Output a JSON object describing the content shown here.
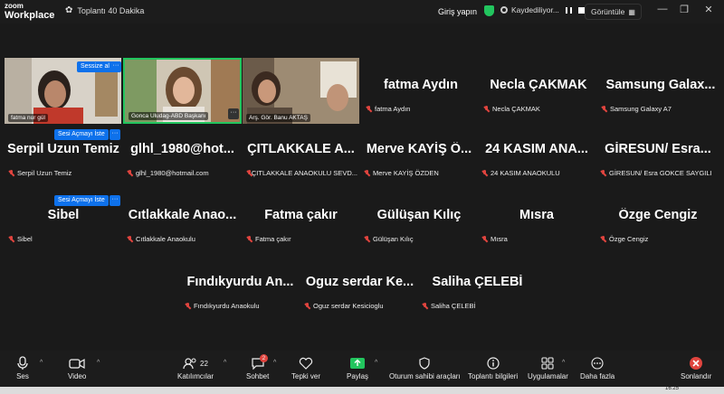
{
  "window": {
    "logo_line1": "zoom",
    "logo_line2": "Workplace",
    "meeting_title": "Toplantı 40 Dakika",
    "join_label": "Giriş yapın",
    "recording_label": "Kaydediliyor...",
    "view_label": "Görüntüle",
    "minimize": "—",
    "restore": "❐",
    "close": "✕"
  },
  "video_tiles": [
    {
      "label": "fatma nur gül",
      "mute_label": "Sessize al"
    },
    {
      "label": "Gonca Uludag-ABD Başkanı"
    },
    {
      "label": "Arş. Gör. Banu AKTAŞ"
    },
    {
      "label": ""
    }
  ],
  "participants": [
    {
      "big": "fatma Aydın",
      "small": "fatma Aydın"
    },
    {
      "big": "Necla ÇAKMAK",
      "small": "Necla ÇAKMAK"
    },
    {
      "big": "Samsung Galax...",
      "small": "Samsung Galaxy A7"
    },
    {
      "big": "Serpil Uzun Temiz",
      "small": "Serpil Uzun Temiz"
    },
    {
      "big": "glhl_1980@hot...",
      "small": "glhl_1980@hotmail.com"
    },
    {
      "big": "ÇITLAKKALE A...",
      "small": "ÇITLAKKALE ANAOKULU SEVD..."
    },
    {
      "big": "Merve KAYİŞ Ö...",
      "small": "Merve KAYİŞ ÖZDEN"
    },
    {
      "big": "24 KASIM ANA...",
      "small": "24 KASIM ANAOKULU"
    },
    {
      "big": "GİRESUN/ Esra...",
      "small": "GİRESUN/ Esra GOKCE SAYGILI"
    },
    {
      "big": "Sibel",
      "small": "Sibel"
    },
    {
      "big": "Cıtlakkale Anao...",
      "small": "Cıtlakkale Anaokulu"
    },
    {
      "big": "Fatma çakır",
      "small": "Fatma çakır"
    },
    {
      "big": "Gülüşan Kılıç",
      "small": "Gülüşan Kılıç"
    },
    {
      "big": "Mısra",
      "small": "Mısra"
    },
    {
      "big": "Özge Cengiz",
      "small": "Özge Cengiz"
    },
    {
      "big": "Fındıkyurdu An...",
      "small": "Fındıkyurdu Anaokulu"
    },
    {
      "big": "Oguz serdar Ke...",
      "small": "Oguz serdar Kesicioglu"
    },
    {
      "big": "Saliha ÇELEBİ",
      "small": "Saliha ÇELEBİ"
    }
  ],
  "unmute_request_label": "Sesi Açmayı İste",
  "more_dots": "···",
  "toolbar": {
    "audio": "Ses",
    "video": "Video",
    "participants": "Katılımcılar",
    "participants_count": "22",
    "chat": "Sohbet",
    "chat_badge": "2",
    "reactions": "Tepki ver",
    "share": "Paylaş",
    "host_tools": "Oturum sahibi araçları",
    "meeting_info": "Toplantı bilgileri",
    "apps": "Uygulamalar",
    "more": "Daha fazla",
    "end": "Sonlandır"
  },
  "taskbar": {
    "clock": "16:25"
  },
  "colors": {
    "accent": "#0e71eb",
    "end": "#e0443e",
    "share": "#22c55e",
    "active_speaker": "#22c55e"
  }
}
